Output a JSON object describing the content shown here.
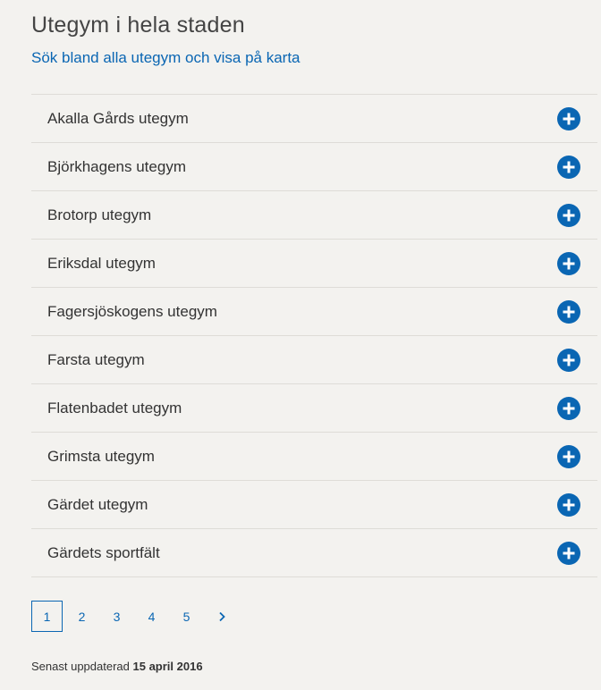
{
  "header": {
    "title": "Utegym i hela staden",
    "search_link": "Sök bland alla utegym och visa på karta"
  },
  "list": {
    "items": [
      {
        "label": "Akalla Gårds utegym"
      },
      {
        "label": "Björkhagens utegym"
      },
      {
        "label": "Brotorp utegym"
      },
      {
        "label": "Eriksdal utegym"
      },
      {
        "label": "Fagersjöskogens utegym"
      },
      {
        "label": "Farsta utegym"
      },
      {
        "label": "Flatenbadet utegym"
      },
      {
        "label": "Grimsta utegym"
      },
      {
        "label": "Gärdet utegym"
      },
      {
        "label": "Gärdets sportfält"
      }
    ],
    "expand_icon": "plus-circle-icon"
  },
  "pagination": {
    "current": "1",
    "pages": [
      "1",
      "2",
      "3",
      "4",
      "5"
    ],
    "next_icon": "chevron-right-icon"
  },
  "footer": {
    "updated_prefix": "Senast uppdaterad",
    "updated_date": "15 april 2016"
  },
  "colors": {
    "accent": "#0a66b3",
    "background": "#f3f2ef",
    "divider": "#dedcd7"
  }
}
